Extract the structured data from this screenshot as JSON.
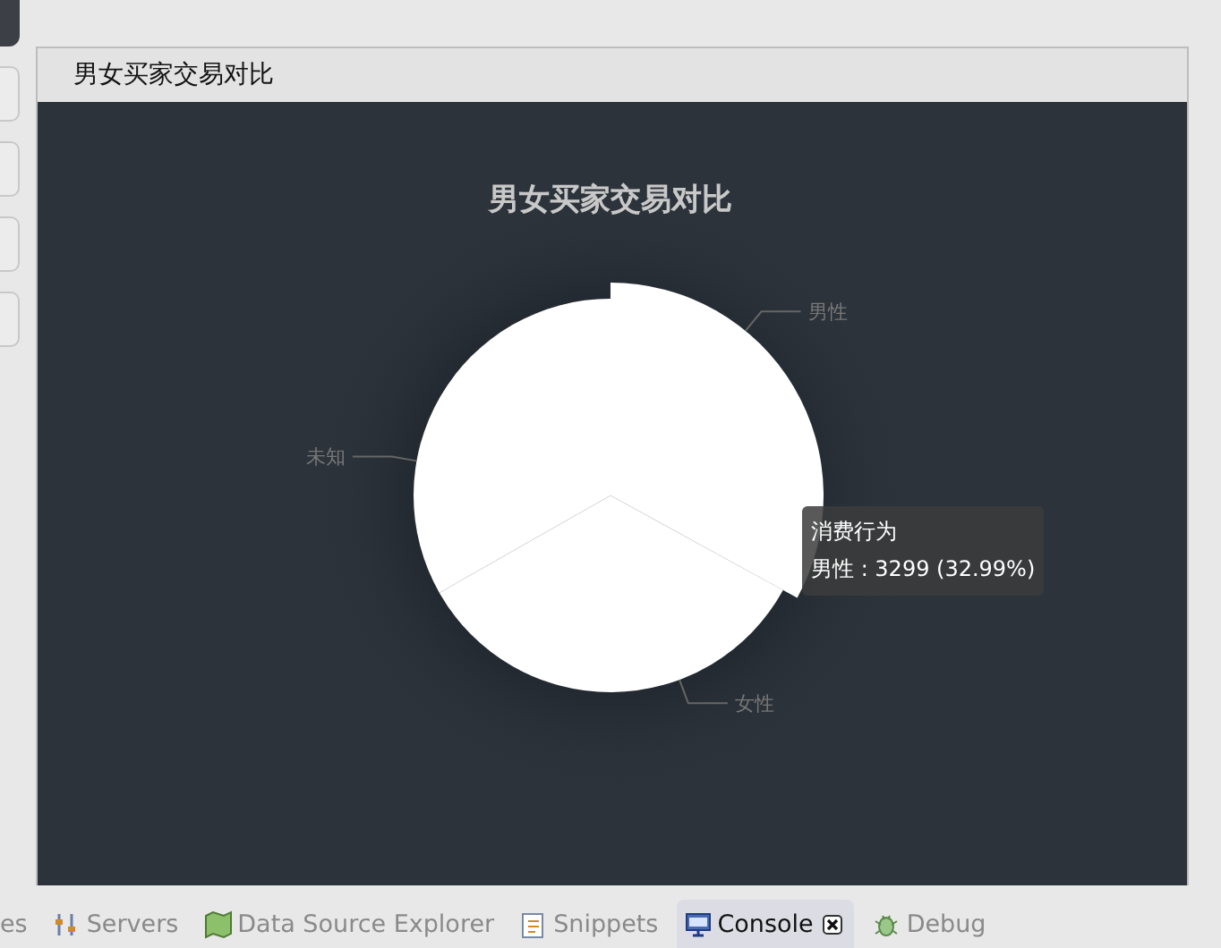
{
  "panel": {
    "title": "男女买家交易对比"
  },
  "chart": {
    "chart_data": {
      "type": "pie",
      "title": "男女买家交易对比",
      "categories": [
        "男性",
        "女性",
        "未知"
      ],
      "series": [
        {
          "name": "消费行为",
          "color": "#ffffff",
          "values": [
            32.99,
            33.77,
            33.24
          ]
        }
      ]
    },
    "tooltip": {
      "text": "男性 : 3299 (32.99%)"
    }
  },
  "bottom_tabs": [
    {
      "label": "es",
      "selected": false,
      "kind": "plain"
    },
    {
      "label": "Servers",
      "selected": false,
      "kind": "servers"
    },
    {
      "label": "Data Source Explorer",
      "selected": false,
      "kind": "map"
    },
    {
      "label": "Snippets",
      "selected": false,
      "kind": "snippets"
    },
    {
      "label": "Console",
      "selected": true,
      "kind": "console",
      "closable": true
    },
    {
      "label": "Debug",
      "selected": false,
      "kind": "bug"
    }
  ]
}
